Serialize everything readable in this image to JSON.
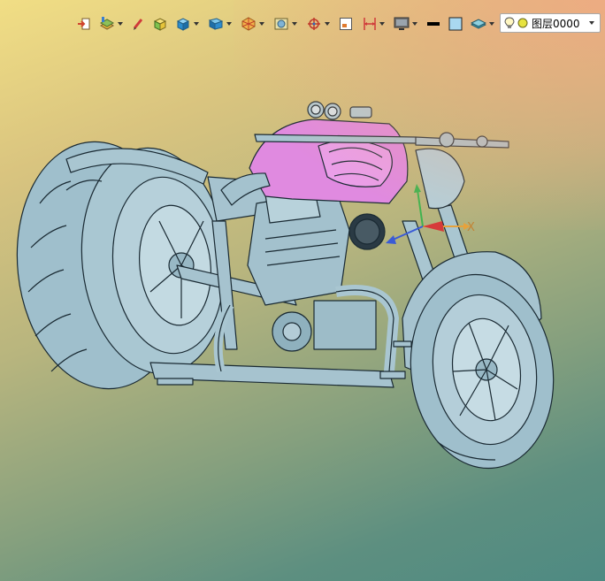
{
  "toolbar": {
    "buttons": [
      {
        "name": "exit-sketch-icon",
        "dropdown": false
      },
      {
        "name": "layer-tools-icon",
        "dropdown": true
      },
      {
        "name": "pencil-icon",
        "dropdown": false
      },
      {
        "name": "box-primitive-icon",
        "dropdown": false
      },
      {
        "name": "solid-cube-icon",
        "dropdown": true
      },
      {
        "name": "view-orientation-icon",
        "dropdown": true
      },
      {
        "name": "shading-mode-icon",
        "dropdown": true
      },
      {
        "name": "section-view-icon",
        "dropdown": true
      },
      {
        "name": "snap-target-icon",
        "dropdown": true
      },
      {
        "name": "fit-window-icon",
        "dropdown": false
      },
      {
        "name": "dimension-icon",
        "dropdown": true
      },
      {
        "name": "display-monitor-icon",
        "dropdown": true
      },
      {
        "name": "line-color-swatch-icon",
        "dropdown": false
      },
      {
        "name": "fill-color-swatch-icon",
        "dropdown": false
      },
      {
        "name": "surface-layer-icon",
        "dropdown": true
      }
    ],
    "layer": {
      "label": "图层0000",
      "visibility_icon": "lightbulb-icon",
      "status_icon": "layer-status-circle-icon"
    }
  },
  "viewport": {
    "axis_x_label": "X",
    "model": "motorcycle"
  },
  "colors": {
    "model_body": "#a7c4cf",
    "fuel_tank": "#e08ae0",
    "edges": "#1a2a33",
    "axis_x": "#e6a23c",
    "axis_y": "#3fb34f",
    "axis_z": "#3a5bd6"
  }
}
